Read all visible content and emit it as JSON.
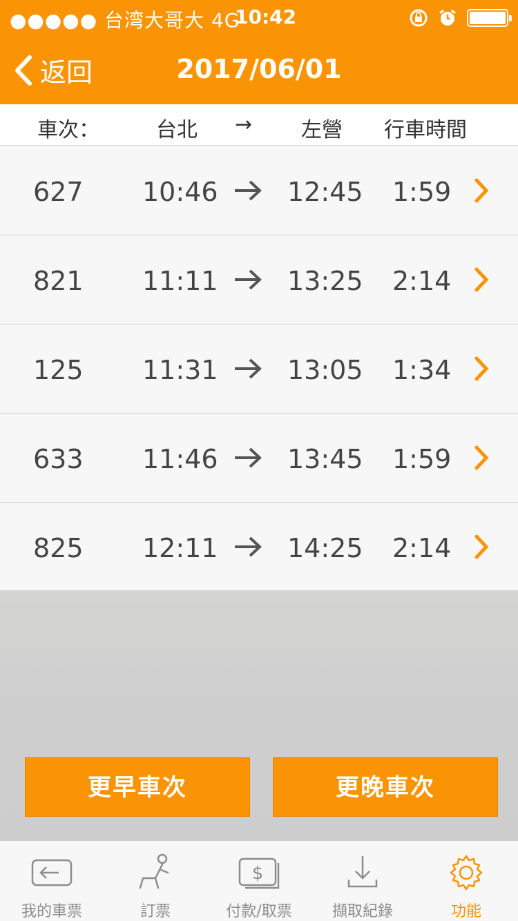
{
  "status_bar": {
    "carrier": "●●●●● 台湾大哥大  4G",
    "time": "10:42"
  },
  "nav": {
    "back_label": "返回",
    "title": "2017/06/01"
  },
  "columns": {
    "train": "車次：",
    "origin": "台北",
    "arrow": "→",
    "destination": "左營",
    "duration": "行車時間"
  },
  "trains": [
    {
      "number": "627",
      "depart": "10:46",
      "arrive": "12:45",
      "duration": "1:59"
    },
    {
      "number": "821",
      "depart": "11:11",
      "arrive": "13:25",
      "duration": "2:14"
    },
    {
      "number": "125",
      "depart": "11:31",
      "arrive": "13:05",
      "duration": "1:34"
    },
    {
      "number": "633",
      "depart": "11:46",
      "arrive": "13:45",
      "duration": "1:59"
    },
    {
      "number": "825",
      "depart": "12:11",
      "arrive": "14:25",
      "duration": "2:14"
    }
  ],
  "row_arrow": "→",
  "buttons": {
    "earlier": "更早車次",
    "later": "更晚車次"
  },
  "tabs": [
    {
      "label": "我的車票",
      "icon": "ticket-icon"
    },
    {
      "label": "訂票",
      "icon": "seat-icon"
    },
    {
      "label": "付款/取票",
      "icon": "payment-icon"
    },
    {
      "label": "擷取紀錄",
      "icon": "download-icon"
    },
    {
      "label": "功能",
      "icon": "gear-icon"
    }
  ],
  "colors": {
    "accent": "#fb9405",
    "tab_inactive": "#8d8d8d"
  }
}
